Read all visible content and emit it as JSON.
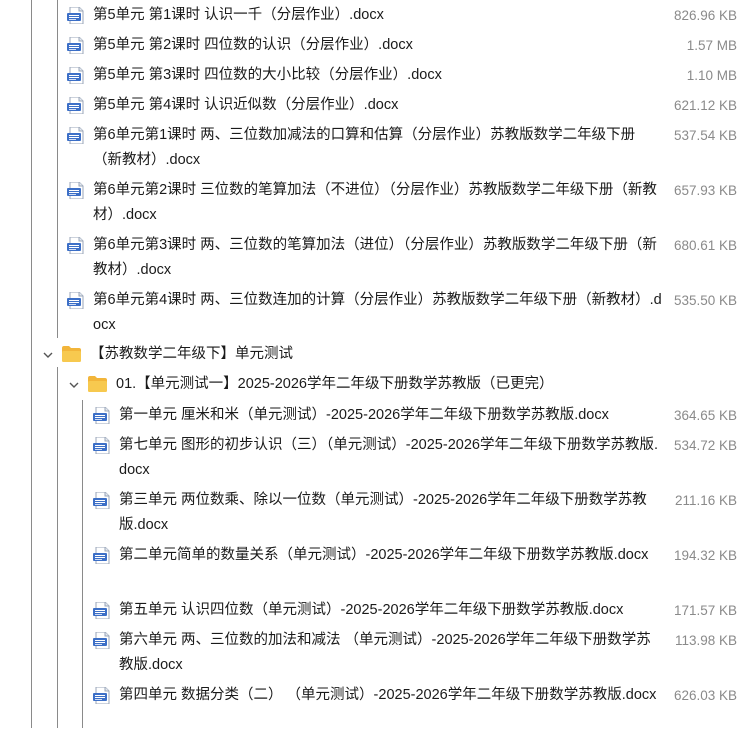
{
  "files_top": [
    {
      "name": "第5单元 第1课时 认识一千（分层作业）.docx",
      "size": "826.96 KB"
    },
    {
      "name": "第5单元 第2课时 四位数的认识（分层作业）.docx",
      "size": "1.57 MB"
    },
    {
      "name": "第5单元 第3课时 四位数的大小比较（分层作业）.docx",
      "size": "1.10 MB"
    },
    {
      "name": "第5单元 第4课时 认识近似数（分层作业）.docx",
      "size": "621.12 KB"
    },
    {
      "name": "第6单元第1课时 两、三位数加减法的口算和估算（分层作业）苏教版数学二年级下册（新教材）.docx",
      "size": "537.54 KB"
    },
    {
      "name": "第6单元第2课时 三位数的笔算加法（不进位）（分层作业）苏教版数学二年级下册（新教材）.docx",
      "size": "657.93 KB"
    },
    {
      "name": "第6单元第3课时 两、三位数的笔算加法（进位）（分层作业）苏教版数学二年级下册（新教材）.docx",
      "size": "680.61 KB"
    },
    {
      "name": "第6单元第4课时 两、三位数连加的计算（分层作业）苏教版数学二年级下册（新教材）.docx",
      "size": "535.50 KB"
    }
  ],
  "folder_level1": "【苏教数学二年级下】单元测试",
  "folder_level2": "01.【单元测试一】2025-2026学年二年级下册数学苏教版（已更完）",
  "files_bottom": [
    {
      "name": "第一单元 厘米和米（单元测试）-2025-2026学年二年级下册数学苏教版.docx",
      "size": "364.65 KB"
    },
    {
      "name": "第七单元 图形的初步认识（三）（单元测试）-2025-2026学年二年级下册数学苏教版.docx",
      "size": "534.72 KB"
    },
    {
      "name": "第三单元 两位数乘、除以一位数（单元测试）-2025-2026学年二年级下册数学苏教版.docx",
      "size": "211.16 KB"
    },
    {
      "name": "第二单元简单的数量关系（单元测试）-2025-2026学年二年级下册数学苏教版.docx",
      "size": "194.32 KB"
    },
    {
      "name": "第五单元 认识四位数（单元测试）-2025-2026学年二年级下册数学苏教版.docx",
      "size": "171.57 KB"
    },
    {
      "name": "第六单元 两、三位数的加法和减法 （单元测试）-2025-2026学年二年级下册数学苏教版.docx",
      "size": "113.98 KB"
    },
    {
      "name": "第四单元 数据分类（二） （单元测试）-2025-2026学年二年级下册数学苏教版.docx",
      "size": "626.03 KB"
    }
  ],
  "colors": {
    "folder": "#f2b53a",
    "tree_line": "#8a8a8a",
    "size_text": "#8a8a8a",
    "doc_icon": "#3c6fc7"
  }
}
